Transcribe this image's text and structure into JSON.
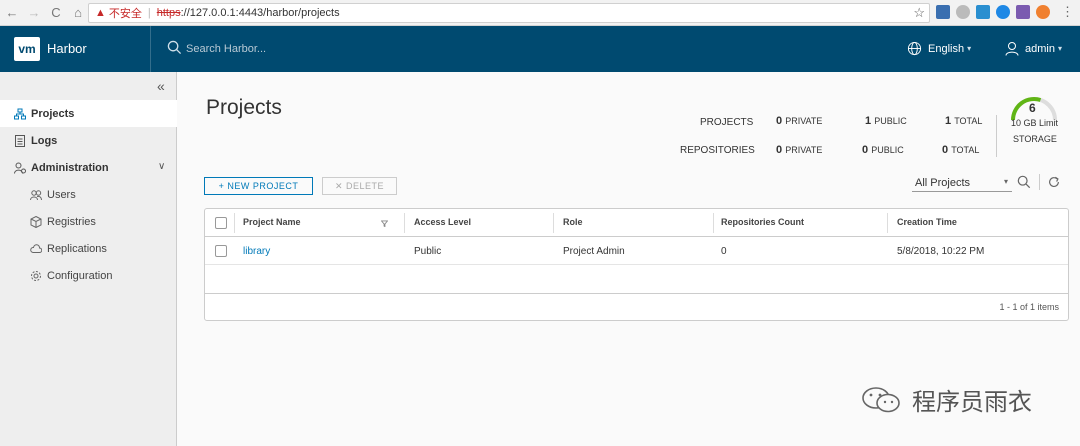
{
  "browser": {
    "warning_text": "不安全",
    "url_scheme": "https",
    "url_rest": "://127.0.0.1:4443/harbor/projects"
  },
  "header": {
    "logo_text": "vm",
    "brand": "Harbor",
    "search_placeholder": "Search Harbor...",
    "language": "English",
    "user": "admin"
  },
  "sidebar": {
    "items": [
      {
        "label": "Projects",
        "icon": "projects-icon"
      },
      {
        "label": "Logs",
        "icon": "logs-icon"
      },
      {
        "label": "Administration",
        "icon": "administration-icon"
      },
      {
        "label": "Users",
        "icon": "users-icon"
      },
      {
        "label": "Registries",
        "icon": "registries-icon"
      },
      {
        "label": "Replications",
        "icon": "replications-icon"
      },
      {
        "label": "Configuration",
        "icon": "configuration-icon"
      }
    ]
  },
  "main": {
    "title": "Projects",
    "stats": {
      "projects_label": "PROJECTS",
      "repositories_label": "REPOSITORIES",
      "projects_private": "0",
      "projects_public": "1",
      "projects_total": "1",
      "repos_private": "0",
      "repos_public": "0",
      "repos_total": "0",
      "private_label": "PRIVATE",
      "public_label": "PUBLIC",
      "total_label": "TOTAL"
    },
    "storage": {
      "used": "6",
      "limit": "10 GB Limit",
      "label": "STORAGE",
      "fraction": 0.6
    },
    "buttons": {
      "new_project": "+ NEW PROJECT",
      "delete": "✕ DELETE"
    },
    "filter": "All Projects",
    "table": {
      "columns": [
        "Project Name",
        "Access Level",
        "Role",
        "Repositories Count",
        "Creation Time"
      ],
      "rows": [
        {
          "name": "library",
          "access": "Public",
          "role": "Project Admin",
          "count": "0",
          "created": "5/8/2018, 10:22 PM"
        }
      ],
      "footer": "1 - 1 of 1 items"
    }
  },
  "watermark": "程序员雨衣",
  "colors": {
    "header_bg": "#004a70",
    "accent": "#0079b8",
    "gauge": "#60b515"
  }
}
